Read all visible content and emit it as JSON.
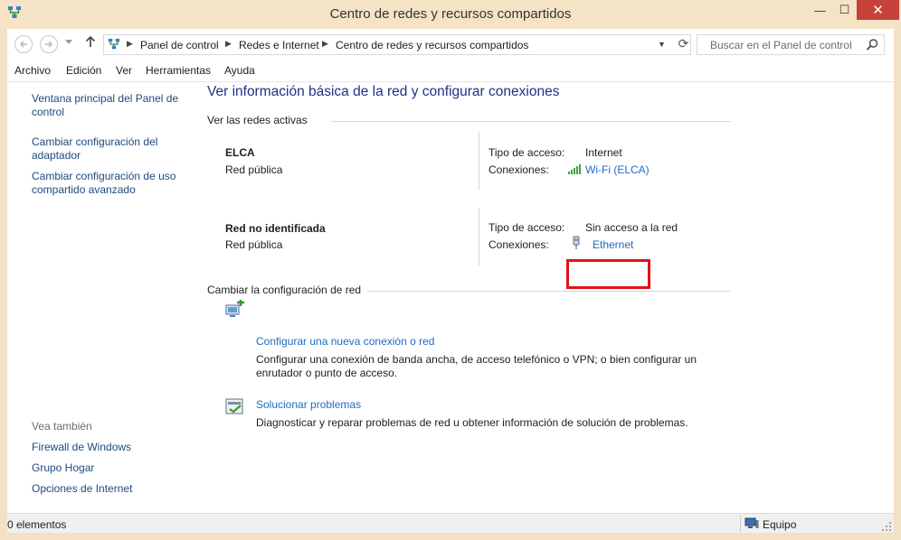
{
  "window": {
    "title": "Centro de redes y recursos compartidos",
    "minimize_glyph": "—",
    "maximize_glyph": "☐",
    "close_glyph": "✕"
  },
  "address": {
    "breadcrumbs": [
      "Panel de control",
      "Redes e Internet",
      "Centro de redes y recursos compartidos"
    ],
    "search_placeholder": "Buscar en el Panel de control"
  },
  "menu": [
    "Archivo",
    "Edición",
    "Ver",
    "Herramientas",
    "Ayuda"
  ],
  "sidebar": {
    "links": [
      "Ventana principal del Panel de control",
      "Cambiar configuración del adaptador",
      "Cambiar configuración de uso compartido avanzado"
    ],
    "see_also_title": "Vea también",
    "see_also": [
      "Firewall de Windows",
      "Grupo Hogar",
      "Opciones de Internet"
    ]
  },
  "main": {
    "heading": "Ver información básica de la red y configurar conexiones",
    "active_networks_title": "Ver las redes activas",
    "access_label": "Tipo de acceso:",
    "connections_label": "Conexiones:",
    "networks": [
      {
        "name": "ELCA",
        "category": "Red pública",
        "access": "Internet",
        "connection": "Wi-Fi (ELCA)",
        "connection_icon": "wifi-signal-icon"
      },
      {
        "name": "Red no identificada",
        "category": "Red pública",
        "access": "Sin acceso a la red",
        "connection": "Ethernet",
        "connection_icon": "ethernet-icon"
      }
    ],
    "change_title": "Cambiar la configuración de red",
    "tasks": [
      {
        "title": "Configurar una nueva conexión o red",
        "description": "Configurar una conexión de banda ancha, de acceso telefónico o VPN; o bien configurar un enrutador o punto de acceso.",
        "icon": "new-connection-icon"
      },
      {
        "title": "Solucionar problemas",
        "description": "Diagnosticar y reparar problemas de red u obtener información de solución de problemas.",
        "icon": "troubleshoot-icon"
      }
    ]
  },
  "status": {
    "items_count": "0 elementos",
    "location": "Equipo"
  },
  "colors": {
    "title_bar": "#f5e3c6",
    "close_button": "#c7423a",
    "link": "#1f6bc2",
    "heading": "#1e3287",
    "highlight_box": "#e3111a"
  }
}
